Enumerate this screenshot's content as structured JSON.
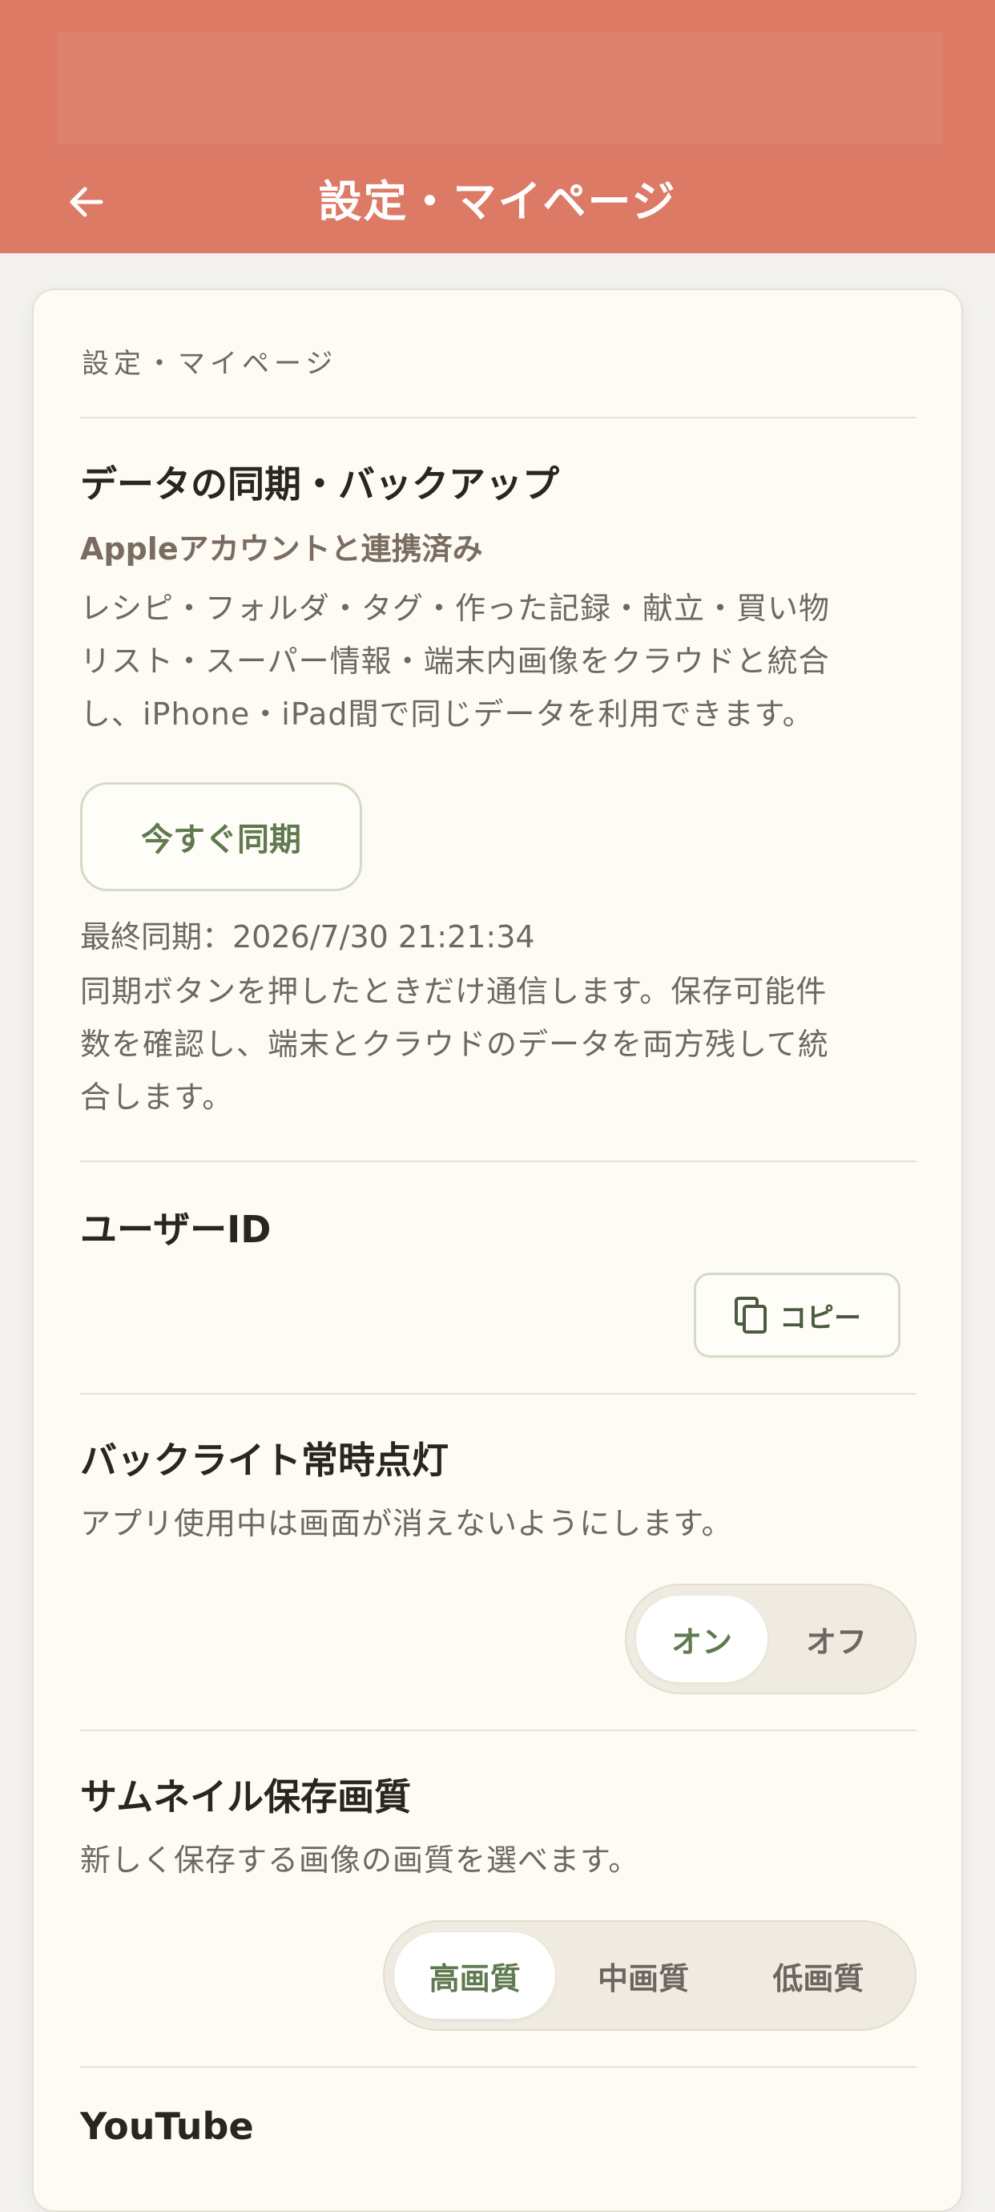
{
  "header": {
    "title": "設定・マイページ",
    "back_icon": "arrow-left-icon",
    "background_color": "#dc7a66"
  },
  "card": {
    "kicker": "設定・マイページ"
  },
  "sync": {
    "title": "データの同期・バックアップ",
    "account_status": "Appleアカウントと連携済み",
    "description_lines": [
      "レシピ・フォルダ・タグ・作った記録・献立・買い物",
      "リスト・スーパー情報・端末内画像をクラウドと統合",
      "し、iPhone・iPad間で同じデータを利用できます。"
    ],
    "button_label": "今すぐ同期",
    "last_sync": "最終同期：2026/7/30 21:21:34",
    "note_lines": [
      "同期ボタンを押したときだけ通信します。保存可能件",
      "数を確認し、端末とクラウドのデータを両方残して統",
      "合します。"
    ]
  },
  "user_id": {
    "title": "ユーザーID",
    "copy_label": "コピー",
    "copy_icon": "copy-icon"
  },
  "backlight": {
    "title": "バックライト常時点灯",
    "description": "アプリ使用中は画面が消えないようにします。",
    "options": [
      "オン",
      "オフ"
    ],
    "selected": "オン"
  },
  "thumbnail": {
    "title": "サムネイル保存画質",
    "description": "新しく保存する画像の画質を選べます。",
    "options": [
      "高画質",
      "中画質",
      "低画質"
    ],
    "selected": "高画質"
  },
  "youtube": {
    "title": "YouTube"
  },
  "colors": {
    "accent_green": "#5f7a4e",
    "card_background": "#fdfbf3"
  }
}
